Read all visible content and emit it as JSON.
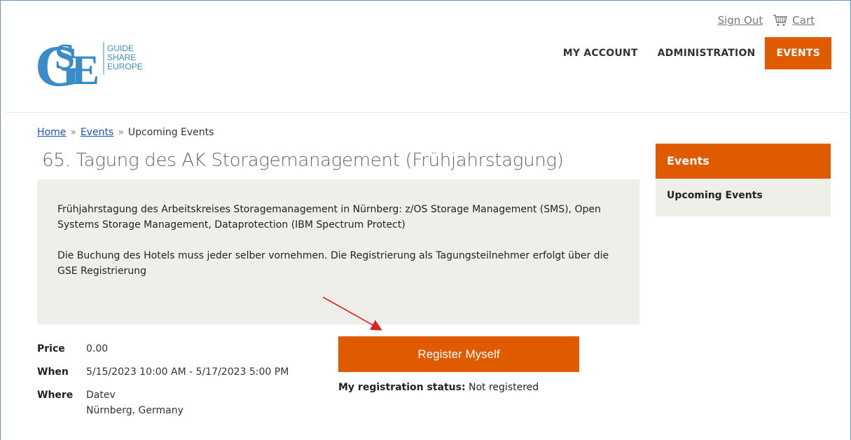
{
  "header": {
    "logo_lines": [
      "GUIDE",
      "SHARE",
      "EUROPE"
    ],
    "util": {
      "sign_out": "Sign Out",
      "cart": "Cart"
    },
    "nav": [
      {
        "label": "MY ACCOUNT",
        "active": false
      },
      {
        "label": "ADMINISTRATION",
        "active": false
      },
      {
        "label": "EVENTS",
        "active": true
      }
    ]
  },
  "breadcrumb": {
    "home": "Home",
    "sep": "»",
    "events": "Events",
    "current": "Upcoming Events"
  },
  "event": {
    "title": "65. Tagung des AK Storagemanagement (Frühjahrstagung)",
    "description": [
      "Frühjahrstagung des Arbeitskreises Storagemanagement in Nürnberg: z/OS Storage Management (SMS), Open Systems Storage Management, Dataprotection (IBM Spectrum Protect)",
      "Die Buchung des Hotels muss jeder selber vornehmen. Die Registrierung als Tagungsteilnehmer erfolgt über die GSE Registrierung"
    ],
    "price_label": "Price",
    "price": "0.00",
    "when_label": "When",
    "when": "5/15/2023 10:00 AM - 5/17/2023 5:00 PM",
    "where_label": "Where",
    "where_line1": "Datev",
    "where_line2": "Nürnberg, Germany",
    "register_label": "Register Myself",
    "status_label": "My registration status:",
    "status_value": "Not registered"
  },
  "sidebar": {
    "title": "Events",
    "item": "Upcoming Events"
  },
  "colors": {
    "accent": "#e05a00",
    "panel": "#eeefe9",
    "link": "#1a55b5",
    "logo": "#3a8cc9",
    "arrow": "#e02020"
  },
  "icons": [
    "cart-icon",
    "annotation-arrow-icon"
  ]
}
